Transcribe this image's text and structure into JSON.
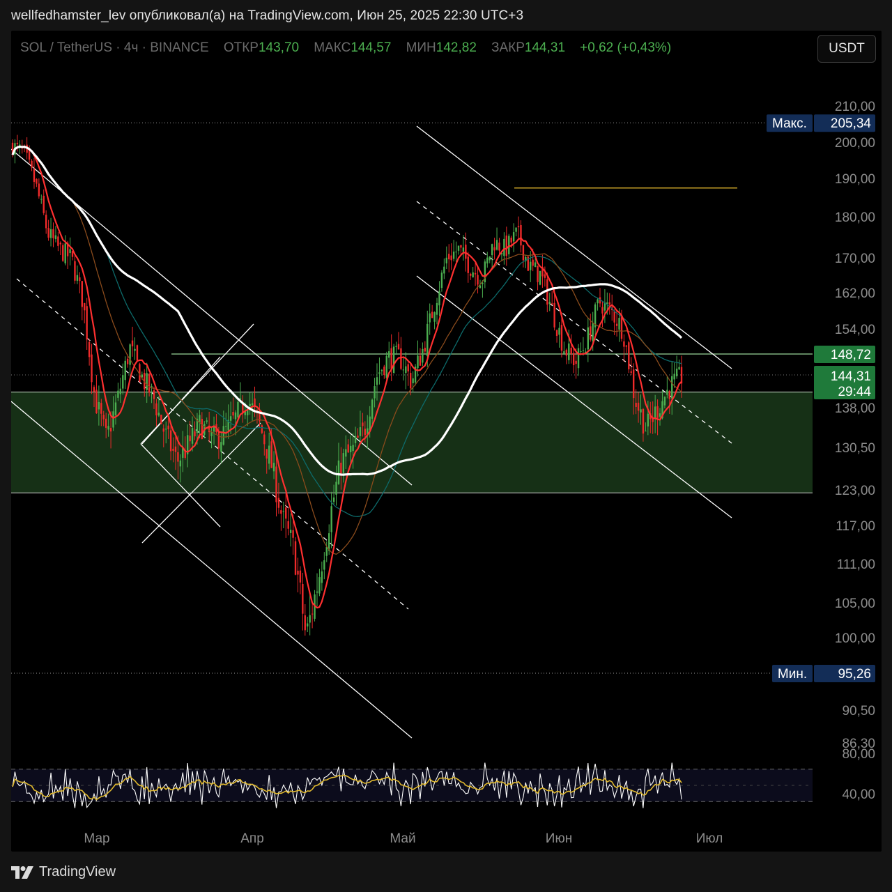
{
  "publish_line": "wellfedhamster_lev опубликовал(а) на TradingView.com, Июн 25, 2025 22:30 UTC+3",
  "legend": {
    "symbol": "SOL / TetherUS · 4ч · BINANCE",
    "open_label": "ОТКР",
    "open": "143,70",
    "high_label": "МАКС",
    "high": "144,57",
    "low_label": "МИН",
    "low": "142,82",
    "close_label": "ЗАКР",
    "close": "144,31",
    "change": "+0,62 (+0,43%)"
  },
  "currency_button": "USDT",
  "colors": {
    "up": "#4caf50",
    "down": "#ef2a2a",
    "ma_white": "#ffffff",
    "ma_red": "#ff3030",
    "zone": "#163016",
    "gold": "#c9a227",
    "badge_blue": "#132d57",
    "badge_green": "#1f7a3a"
  },
  "chart_data": {
    "type": "candlestick",
    "symbol": "SOL / TetherUS",
    "timeframe": "4ч",
    "exchange": "BINANCE",
    "price_axis_ticks": [
      "210,00",
      "200,00",
      "190,00",
      "180,00",
      "170,00",
      "162,00",
      "154,00",
      "138,00",
      "130,50",
      "123,00",
      "117,00",
      "111,00",
      "105,00",
      "100,00",
      "90,50",
      "86,30"
    ],
    "price_axis_tick_values": [
      210,
      200,
      190,
      180,
      170,
      162,
      154,
      138,
      130.5,
      123,
      117,
      111,
      105,
      100,
      90.5,
      86.3
    ],
    "time_axis_labels": [
      "Мар",
      "Апр",
      "Май",
      "Июн",
      "Июл"
    ],
    "close_path": [
      [
        0,
        199
      ],
      [
        5,
        197
      ],
      [
        10,
        188
      ],
      [
        15,
        176
      ],
      [
        20,
        172
      ],
      [
        25,
        170
      ],
      [
        30,
        160
      ],
      [
        35,
        140
      ],
      [
        40,
        132
      ],
      [
        45,
        140
      ],
      [
        50,
        150
      ],
      [
        55,
        144
      ],
      [
        60,
        140
      ],
      [
        65,
        133
      ],
      [
        70,
        128
      ],
      [
        75,
        131
      ],
      [
        80,
        135
      ],
      [
        85,
        132
      ],
      [
        90,
        133
      ],
      [
        95,
        136
      ],
      [
        100,
        140
      ],
      [
        105,
        135
      ],
      [
        110,
        128
      ],
      [
        115,
        118
      ],
      [
        120,
        113
      ],
      [
        125,
        100
      ],
      [
        130,
        108
      ],
      [
        135,
        118
      ],
      [
        140,
        128
      ],
      [
        145,
        130
      ],
      [
        150,
        134
      ],
      [
        155,
        144
      ],
      [
        160,
        148
      ],
      [
        165,
        148
      ],
      [
        170,
        143
      ],
      [
        175,
        150
      ],
      [
        180,
        160
      ],
      [
        185,
        170
      ],
      [
        190,
        172
      ],
      [
        195,
        168
      ],
      [
        200,
        165
      ],
      [
        205,
        174
      ],
      [
        210,
        172
      ],
      [
        215,
        176
      ],
      [
        220,
        168
      ],
      [
        225,
        166
      ],
      [
        230,
        158
      ],
      [
        235,
        150
      ],
      [
        240,
        147
      ],
      [
        245,
        152
      ],
      [
        250,
        160
      ],
      [
        255,
        158
      ],
      [
        260,
        154
      ],
      [
        265,
        140
      ],
      [
        270,
        134
      ],
      [
        275,
        138
      ],
      [
        280,
        142
      ],
      [
        285,
        144
      ]
    ],
    "highest": {
      "label": "Макс.",
      "value": "205,34"
    },
    "lowest": {
      "label": "Мин.",
      "value": "95,26"
    },
    "current_price": {
      "value": "144,31",
      "countdown": "29:44"
    },
    "resistance_level": {
      "value": "148,72"
    },
    "resistance_top_line": 187.5,
    "support_zone": [
      122.5,
      141.0
    ],
    "rsi": {
      "ticks": [
        "80,00",
        "40,00"
      ],
      "tick_values": [
        80,
        40
      ],
      "band": [
        30,
        70
      ]
    }
  },
  "footer": {
    "brand": "TradingView"
  }
}
